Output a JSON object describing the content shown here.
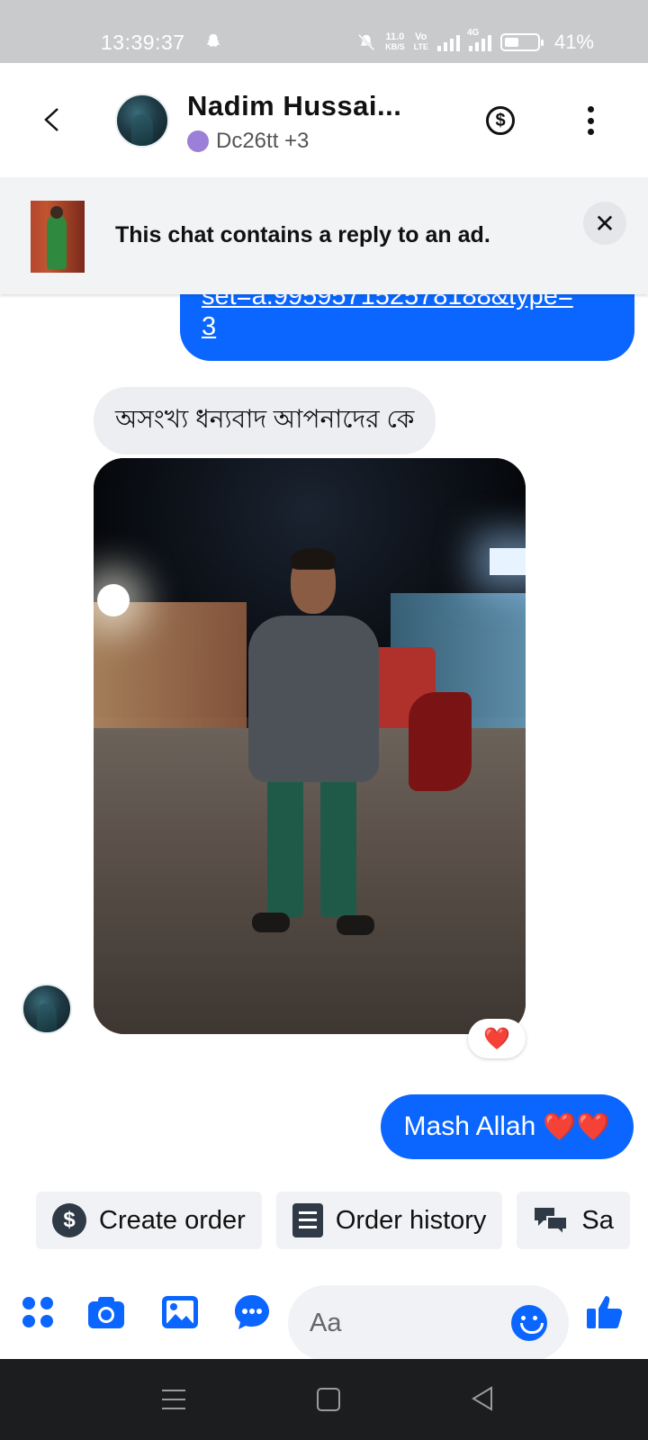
{
  "status_bar": {
    "time": "13:39:37",
    "net_speed_top": "11.0",
    "net_speed_bottom": "KB/S",
    "volte_top": "Vo",
    "volte_bottom": "LTE",
    "net_type": "4G",
    "battery": "41%"
  },
  "header": {
    "contact_name": "Nadim Hussai...",
    "subtitle": "Dc26tt +3"
  },
  "ad_banner": {
    "text": "This chat contains a reply to an ad.",
    "close_glyph": "✕"
  },
  "messages": {
    "link_line1": "set=a.995957152578188&type=",
    "link_line2": "3",
    "incoming_text": "অসংখ্য ধন্যবাদ আপনাদের কে",
    "reaction": "❤️",
    "outgoing_text": "Mash Allah",
    "outgoing_hearts": "❤️❤️"
  },
  "quick_actions": [
    {
      "label": "Create order"
    },
    {
      "label": "Order history"
    },
    {
      "label": "Sa"
    }
  ],
  "composer": {
    "placeholder": "Aa"
  },
  "colors": {
    "accent": "#0a66ff",
    "incoming_bubble": "#eceef1",
    "reaction": "#e0242b"
  }
}
